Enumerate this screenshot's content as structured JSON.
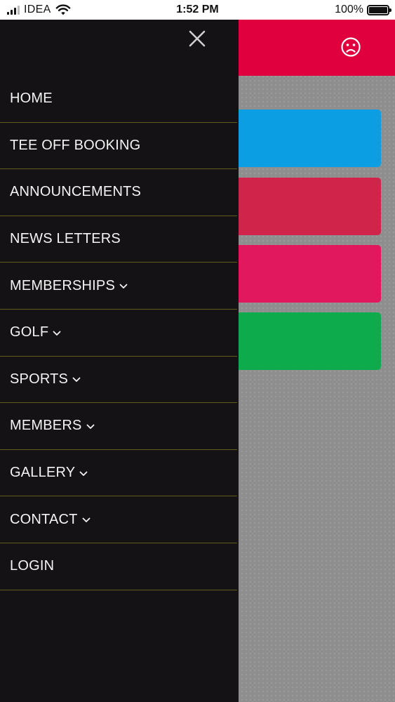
{
  "status_bar": {
    "carrier": "IDEA",
    "time": "1:52 PM",
    "battery": "100%",
    "battery_level": 1.0
  },
  "drawer": {
    "menu_items": [
      {
        "label": "HOME",
        "has_dropdown": false
      },
      {
        "label": "TEE OFF BOOKING",
        "has_dropdown": false
      },
      {
        "label": "ANNOUNCEMENTS",
        "has_dropdown": false
      },
      {
        "label": "NEWS LETTERS",
        "has_dropdown": false
      },
      {
        "label": "MEMBERSHIPS",
        "has_dropdown": true
      },
      {
        "label": "GOLF",
        "has_dropdown": true
      },
      {
        "label": "SPORTS",
        "has_dropdown": true
      },
      {
        "label": "MEMBERS",
        "has_dropdown": true
      },
      {
        "label": "GALLERY",
        "has_dropdown": true
      },
      {
        "label": "CONTACT",
        "has_dropdown": true
      },
      {
        "label": "LOGIN",
        "has_dropdown": false
      }
    ]
  },
  "icons": {
    "close": "close-icon",
    "user": "sad-face-icon",
    "dropdown": "chevron-down-icon"
  },
  "colors": {
    "header": "#e0003e",
    "drawer_bg": "#141214",
    "divider": "#5f5c1c",
    "tile_blue": "#0c9ee2",
    "tile_red": "#d1244a",
    "tile_pink": "#e2185e",
    "tile_green": "#0eab4c"
  }
}
